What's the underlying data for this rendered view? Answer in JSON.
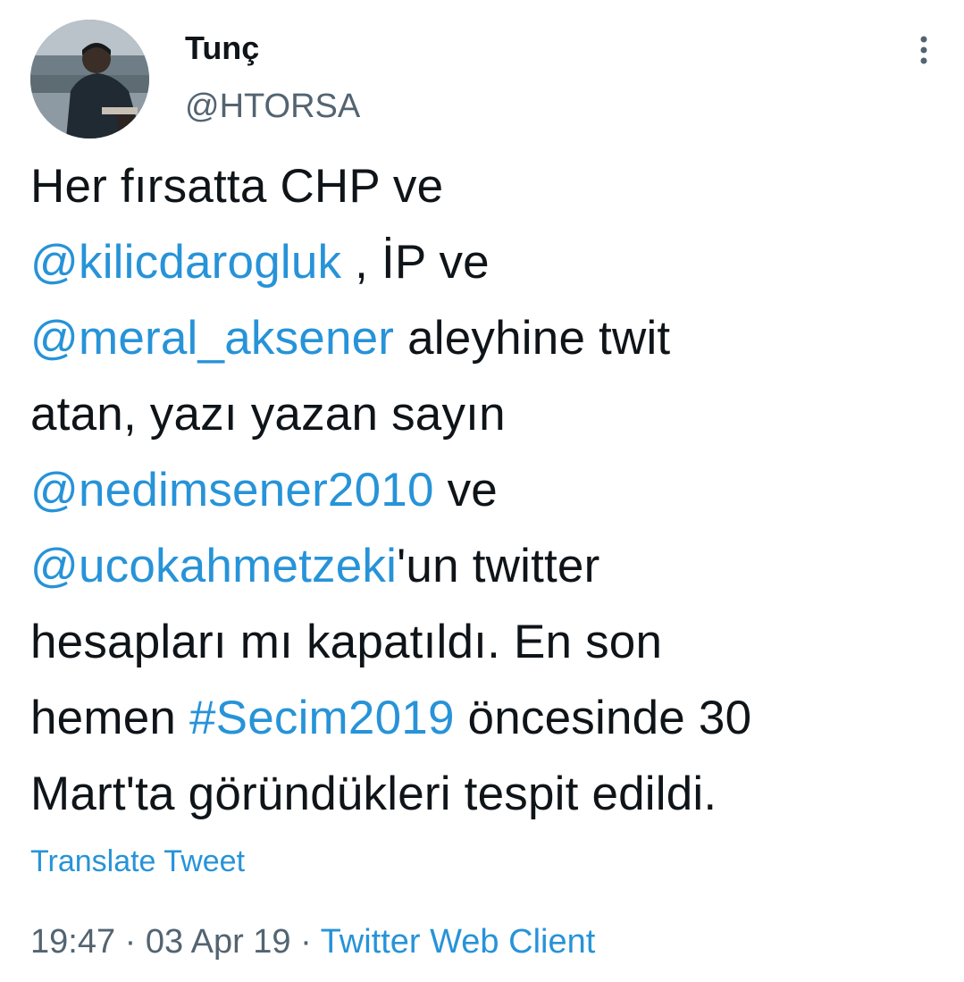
{
  "author": {
    "display_name": "Tunç",
    "handle": "@HTORSA",
    "avatar_alt": "avatar"
  },
  "menu": {
    "icon": "more-vertical-icon"
  },
  "tweet": {
    "segments": {
      "l1_text": "Her fırsatta CHP ve",
      "l2_mention": "@kilicdarogluk",
      "l2_text": " , İP ve",
      "l3_mention": "@meral_aksener",
      "l3_text": " aleyhine twit",
      "l4_text": "atan, yazı yazan sayın",
      "l5_mention": "@nedimsener2010",
      "l5_text": " ve",
      "l6_mention": "@ucokahmetzeki",
      "l6_text": "'un twitter",
      "l7_text": "hesapları mı kapatıldı. En son",
      "l8_text_a": "hemen ",
      "l8_hashtag": "#Secim2019",
      "l8_text_b": " öncesinde 30",
      "l9_text": "Mart'ta göründükleri tespit edildi."
    },
    "translate_label": "Translate Tweet"
  },
  "meta": {
    "time": "19:47",
    "sep1": " · ",
    "date": "03 Apr 19",
    "sep2": " · ",
    "client": "Twitter Web Client"
  },
  "colors": {
    "link": "#2793d8",
    "text": "#0f1419",
    "secondary": "#536471"
  }
}
